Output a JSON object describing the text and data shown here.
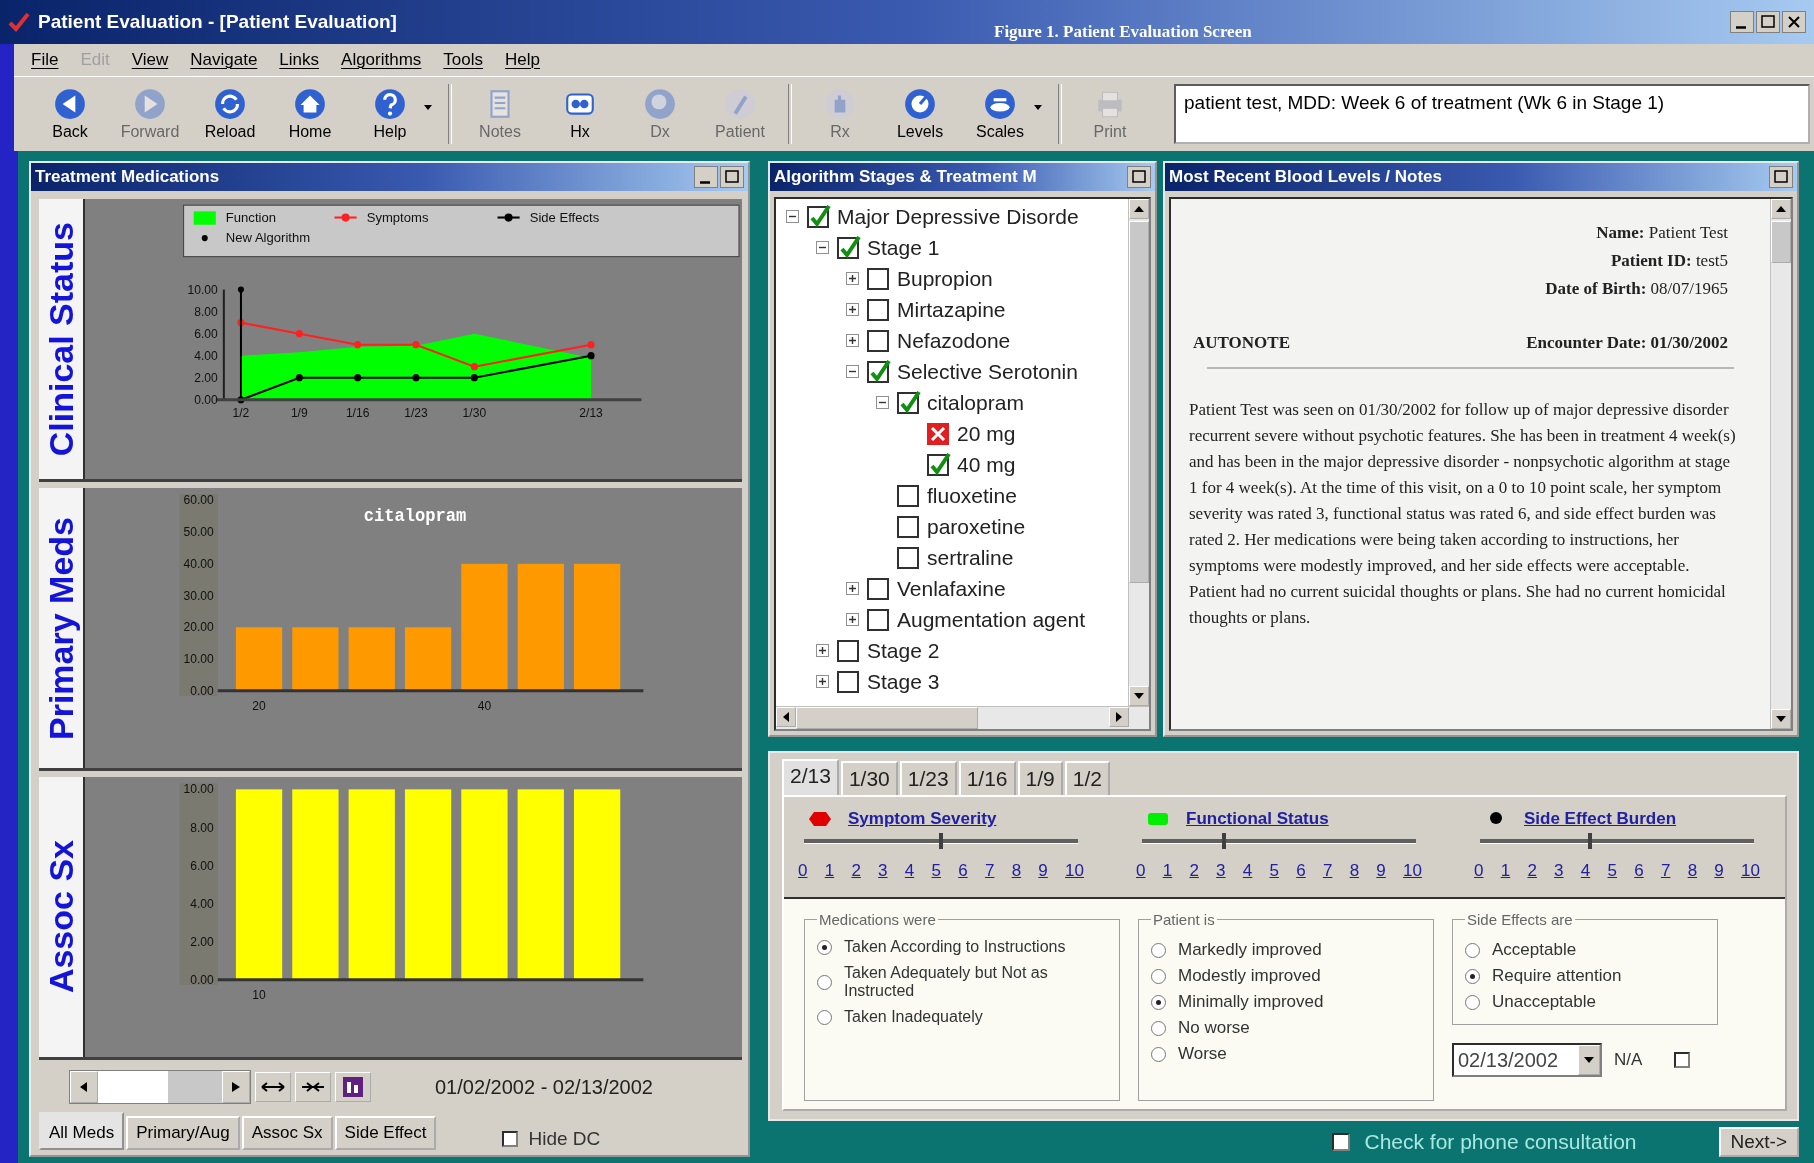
{
  "window": {
    "title": "Patient Evaluation - [Patient Evaluation]",
    "caption": "Figure 1. Patient Evaluation Screen"
  },
  "menu": [
    {
      "label": "File",
      "disabled": false
    },
    {
      "label": "Edit",
      "disabled": true
    },
    {
      "label": "View",
      "disabled": false
    },
    {
      "label": "Navigate",
      "disabled": false
    },
    {
      "label": "Links",
      "disabled": false
    },
    {
      "label": "Algorithms",
      "disabled": false
    },
    {
      "label": "Tools",
      "disabled": false
    },
    {
      "label": "Help",
      "disabled": false
    }
  ],
  "toolbar": {
    "groups": [
      [
        {
          "label": "Back",
          "disabled": false,
          "dropdown": false
        },
        {
          "label": "Forward",
          "disabled": true,
          "dropdown": false
        },
        {
          "label": "Reload",
          "disabled": false,
          "dropdown": false
        },
        {
          "label": "Home",
          "disabled": false,
          "dropdown": false
        },
        {
          "label": "Help",
          "disabled": false,
          "dropdown": true
        }
      ],
      [
        {
          "label": "Notes",
          "disabled": true,
          "dropdown": false
        },
        {
          "label": "Hx",
          "disabled": false,
          "dropdown": false
        },
        {
          "label": "Dx",
          "disabled": true,
          "dropdown": false
        },
        {
          "label": "Patient",
          "disabled": true,
          "dropdown": false
        }
      ],
      [
        {
          "label": "Rx",
          "disabled": true,
          "dropdown": false
        },
        {
          "label": "Levels",
          "disabled": false,
          "dropdown": false
        },
        {
          "label": "Scales",
          "disabled": false,
          "dropdown": true
        }
      ],
      [
        {
          "label": "Print",
          "disabled": true,
          "dropdown": false
        }
      ]
    ],
    "status": "patient test, MDD: Week 6 of treatment (Wk 6 in Stage 1)"
  },
  "treatment_panel": {
    "title": "Treatment Medications",
    "charts": [
      {
        "side_label": "Clinical Status",
        "chart_data": {
          "type": "line",
          "legend": "top",
          "categories": [
            "1/2",
            "1/9",
            "1/16",
            "1/23",
            "1/30",
            null,
            "2/13"
          ],
          "ylim": [
            0,
            10
          ],
          "yticks": [
            {
              "value": 0,
              "label": "0.00"
            },
            {
              "value": 2,
              "label": "2.00"
            },
            {
              "value": 4,
              "label": "4.00"
            },
            {
              "value": 6,
              "label": "6.00"
            },
            {
              "value": 8,
              "label": "8.00"
            },
            {
              "value": 10,
              "label": "10.00"
            }
          ],
          "series": [
            {
              "name": "Function",
              "color": "#00ff00",
              "type": "area",
              "values": [
                4,
                4.3,
                4.8,
                4.9,
                6,
                null,
                3.8
              ]
            },
            {
              "name": "Symptoms",
              "color": "#ff2020",
              "type": "line",
              "marker": true,
              "values": [
                7,
                6,
                5,
                5,
                3,
                null,
                5
              ]
            },
            {
              "name": "Side Effects",
              "color": "#000000",
              "type": "line",
              "marker": true,
              "values": [
                0,
                2,
                2,
                2,
                2,
                null,
                4
              ]
            },
            {
              "name": "New Algorithm",
              "color": "#000000",
              "type": "scatter",
              "values": [
                10,
                null,
                null,
                null,
                null,
                null,
                null
              ]
            }
          ]
        }
      },
      {
        "side_label": "Primary Meds",
        "chart_data": {
          "type": "bar",
          "title": "citalopram",
          "categories": [
            "20",
            null,
            null,
            null,
            "40",
            null,
            null
          ],
          "ylim": [
            0,
            60
          ],
          "yticks": [
            {
              "value": 0,
              "label": "0.00"
            },
            {
              "value": 10,
              "label": "10.00"
            },
            {
              "value": 20,
              "label": "20.00"
            },
            {
              "value": 30,
              "label": "30.00"
            },
            {
              "value": 40,
              "label": "40.00"
            },
            {
              "value": 50,
              "label": "50.00"
            },
            {
              "value": 60,
              "label": "60.00"
            }
          ],
          "series": [
            {
              "color": "#ff9900",
              "values": [
                20,
                20,
                20,
                20,
                40,
                40,
                40
              ]
            }
          ]
        }
      },
      {
        "side_label": "Assoc Sx",
        "chart_data": {
          "type": "bar",
          "categories": [
            "10",
            null,
            null,
            null,
            null,
            null,
            null
          ],
          "ylim": [
            0,
            10
          ],
          "yticks": [
            {
              "value": 0,
              "label": "0.00"
            },
            {
              "value": 2,
              "label": "2.00"
            },
            {
              "value": 4,
              "label": "4.00"
            },
            {
              "value": 6,
              "label": "6.00"
            },
            {
              "value": 8,
              "label": "8.00"
            },
            {
              "value": 10,
              "label": "10.00"
            }
          ],
          "series": [
            {
              "color": "#ffff00",
              "values": [
                10,
                10,
                10,
                10,
                10,
                10,
                10
              ]
            }
          ]
        }
      }
    ],
    "date_range": "01/02/2002 - 02/13/2002",
    "tabs": [
      {
        "label": "All Meds",
        "selected": true
      },
      {
        "label": "Primary/Aug",
        "selected": false
      },
      {
        "label": "Assoc Sx",
        "selected": false
      },
      {
        "label": "Side Effect",
        "selected": false
      }
    ],
    "hide_dc": {
      "label": "Hide DC",
      "checked": false
    }
  },
  "tree_panel": {
    "title": "Algorithm Stages & Treatment M",
    "nodes": [
      {
        "label": "Major Depressive Disorde",
        "checked": true,
        "crossed": false,
        "expanded": true,
        "children": [
          {
            "label": "Stage 1",
            "checked": true,
            "crossed": false,
            "expanded": true,
            "children": [
              {
                "label": "Bupropion",
                "checked": false,
                "crossed": false,
                "expanded": false
              },
              {
                "label": "Mirtazapine",
                "checked": false,
                "crossed": false,
                "expanded": false
              },
              {
                "label": "Nefazodone",
                "checked": false,
                "crossed": false,
                "expanded": false
              },
              {
                "label": "Selective Serotonin",
                "checked": true,
                "crossed": false,
                "expanded": true,
                "children": [
                  {
                    "label": "citalopram",
                    "checked": true,
                    "crossed": false,
                    "expanded": true,
                    "children": [
                      {
                        "label": "20 mg",
                        "checked": false,
                        "crossed": true
                      },
                      {
                        "label": "40 mg",
                        "checked": true,
                        "crossed": false
                      }
                    ]
                  },
                  {
                    "label": "fluoxetine",
                    "checked": false,
                    "crossed": false
                  },
                  {
                    "label": "paroxetine",
                    "checked": false,
                    "crossed": false
                  },
                  {
                    "label": "sertraline",
                    "checked": false,
                    "crossed": false
                  }
                ]
              },
              {
                "label": "Venlafaxine",
                "checked": false,
                "crossed": false,
                "expanded": false
              },
              {
                "label": "Augmentation agent",
                "checked": false,
                "crossed": false,
                "expanded": false
              }
            ]
          },
          {
            "label": "Stage 2",
            "checked": false,
            "crossed": false,
            "expanded": false
          },
          {
            "label": "Stage 3",
            "checked": false,
            "crossed": false,
            "expanded": false
          }
        ]
      }
    ]
  },
  "notes_panel": {
    "title": "Most Recent Blood Levels / Notes",
    "fields": [
      "**Name:** Patient Test",
      "**Patient ID:** test5",
      "**Date of Birth:** 08/07/1965"
    ],
    "heading": "AUTONOTE",
    "encounter": "Encounter Date: 01/30/2002",
    "body": "Patient Test was seen on 01/30/2002 for follow up of major depressive disorder recurrent severe without psychotic features. She has been in treatment 4 week(s) and has been in the major depressive disorder - nonpsychotic algorithm at stage 1 for 4 week(s). At the time of this visit, on a 0 to 10 point scale, her symptom severity was rated 3, functional status was rated 6, and side effect burden was rated 2. Her medications were being taken according to instructions, her symptoms were modestly improved, and her side effects were acceptable. Patient had no current suicidal thoughts or plans. She had no current homicidal thoughts or plans."
  },
  "evaluation": {
    "date_tabs": [
      {
        "label": "2/13",
        "selected": true
      },
      {
        "label": "1/30",
        "selected": false
      },
      {
        "label": "1/23",
        "selected": false
      },
      {
        "label": "1/16",
        "selected": false
      },
      {
        "label": "1/9",
        "selected": false
      },
      {
        "label": "1/2",
        "selected": false
      }
    ],
    "scales": [
      {
        "name": "Symptom Severity",
        "color": "#e00000",
        "level": 0.5,
        "ticks": [
          "0",
          "1",
          "2",
          "3",
          "4",
          "5",
          "6",
          "7",
          "8",
          "9",
          "10"
        ]
      },
      {
        "name": "Functional Status",
        "color": "#00ee00",
        "level": 0.3,
        "ticks": [
          "0",
          "1",
          "2",
          "3",
          "4",
          "5",
          "6",
          "7",
          "8",
          "9",
          "10"
        ]
      },
      {
        "name": "Side Effect Burden",
        "color": "#000000",
        "level": 0.4,
        "ticks": [
          "0",
          "1",
          "2",
          "3",
          "4",
          "5",
          "6",
          "7",
          "8",
          "9",
          "10"
        ]
      }
    ],
    "groups": [
      {
        "title": "Medications were",
        "options": [
          {
            "label": "Taken According to Instructions",
            "selected": true
          },
          {
            "label": "Taken Adequately but Not as Instructed",
            "selected": false
          },
          {
            "label": "Taken Inadequately",
            "selected": false
          }
        ]
      },
      {
        "title": "Patient is",
        "options": [
          {
            "label": "Markedly improved",
            "selected": false
          },
          {
            "label": "Modestly improved",
            "selected": false
          },
          {
            "label": "Minimally improved",
            "selected": true
          },
          {
            "label": "No worse",
            "selected": false
          },
          {
            "label": "Worse",
            "selected": false
          }
        ]
      },
      {
        "title": "Side Effects are",
        "options": [
          {
            "label": "Acceptable",
            "selected": false
          },
          {
            "label": "Require attention",
            "selected": true
          },
          {
            "label": "Unacceptable",
            "selected": false
          }
        ]
      }
    ],
    "date": "02/13/2002",
    "na": {
      "label": "N/A",
      "checked": false
    }
  },
  "footer": {
    "phone": {
      "label": "Check for phone consultation",
      "checked": false
    },
    "next": "Next->"
  }
}
